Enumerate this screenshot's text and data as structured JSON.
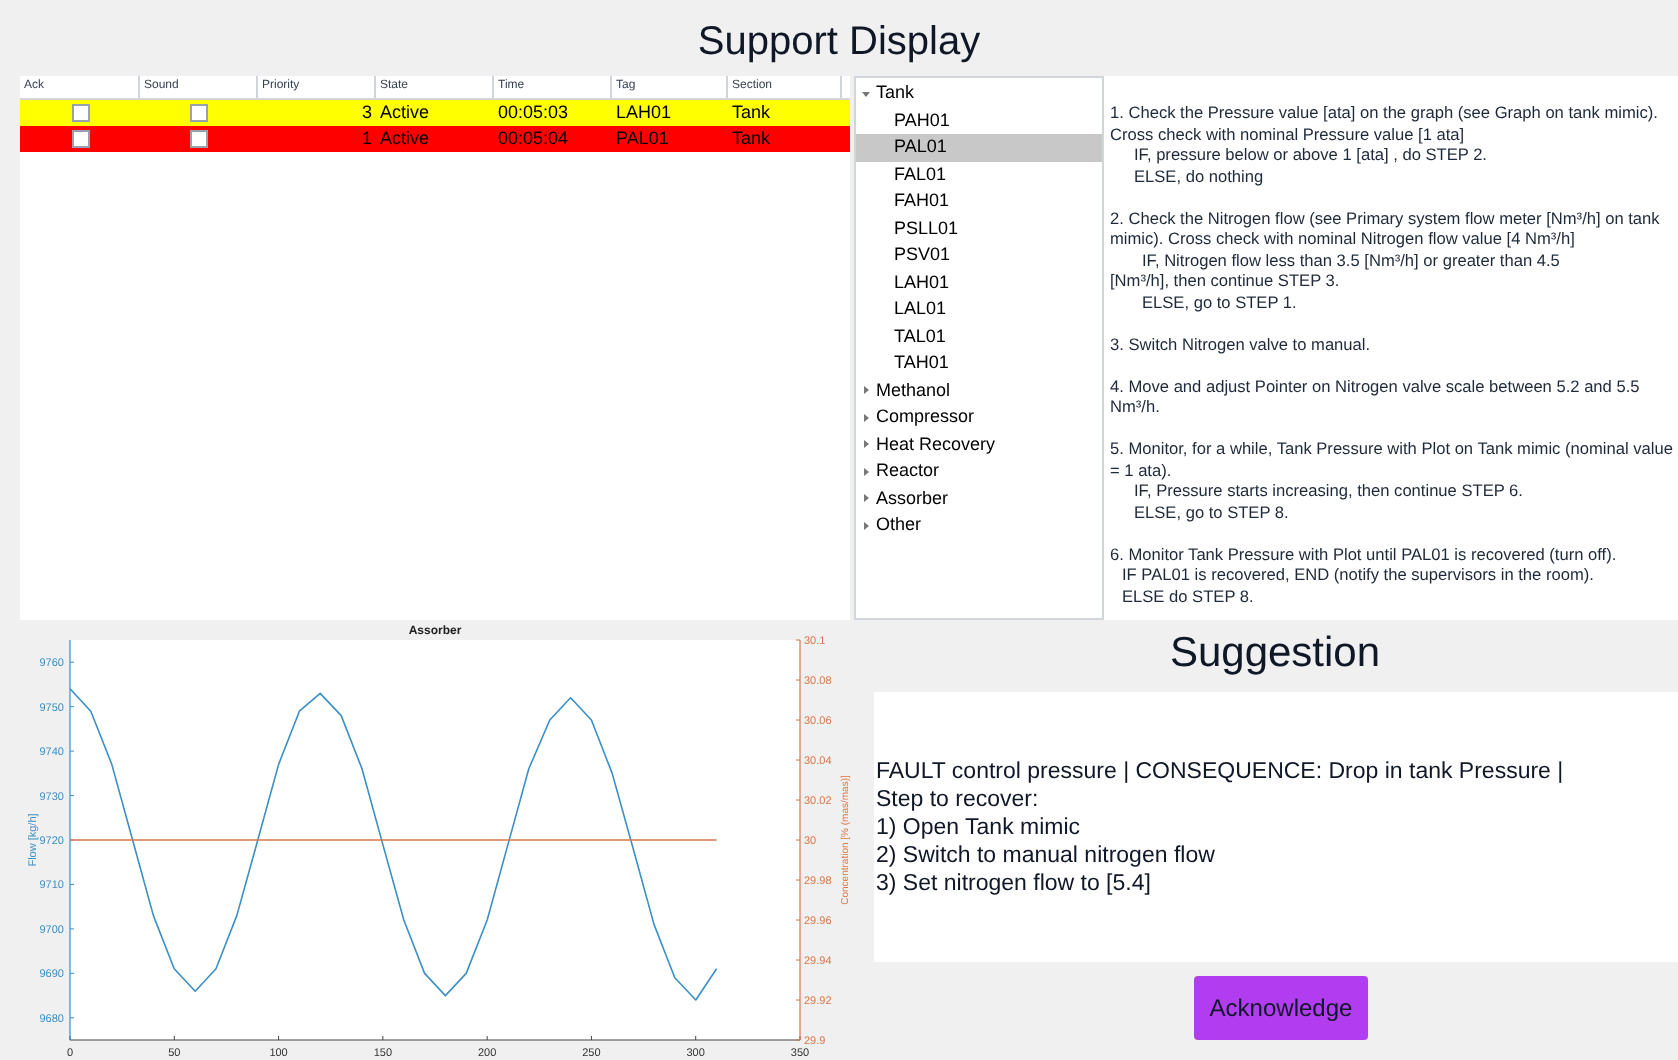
{
  "title": "Support Display",
  "table": {
    "columns": [
      "Ack",
      "Sound",
      "Priority",
      "State",
      "Time",
      "Tag",
      "Section"
    ],
    "rows": [
      {
        "color": "#ffff00",
        "ack": false,
        "sound": false,
        "priority": "3",
        "state": "Active",
        "time": "00:05:03",
        "tag": "LAH01",
        "section": "Tank"
      },
      {
        "color": "#ff0000",
        "ack": false,
        "sound": false,
        "priority": "1",
        "state": "Active",
        "time": "00:05:04",
        "tag": "PAL01",
        "section": "Tank"
      }
    ]
  },
  "tree": [
    {
      "label": "Tank",
      "expanded": true,
      "children": [
        {
          "label": "PAH01",
          "selected": false
        },
        {
          "label": "PAL01",
          "selected": true
        },
        {
          "label": "FAL01",
          "selected": false
        },
        {
          "label": "FAH01",
          "selected": false
        },
        {
          "label": "PSLL01",
          "selected": false
        },
        {
          "label": "PSV01",
          "selected": false
        },
        {
          "label": "LAH01",
          "selected": false
        },
        {
          "label": "LAL01",
          "selected": false
        },
        {
          "label": "TAL01",
          "selected": false
        },
        {
          "label": "TAH01",
          "selected": false
        }
      ]
    },
    {
      "label": "Methanol",
      "expanded": false
    },
    {
      "label": "Compressor",
      "expanded": false
    },
    {
      "label": "Heat Recovery",
      "expanded": false
    },
    {
      "label": "Reactor",
      "expanded": false
    },
    {
      "label": "Assorber",
      "expanded": false
    },
    {
      "label": "Other",
      "expanded": false
    }
  ],
  "procedure": [
    [
      {
        "kind": "main",
        "text": "1.  Check the Pressure value [ata] on the graph (see Graph on tank mimic). Cross check with nominal Pressure value [1 ata]"
      },
      {
        "kind": "sub",
        "text": "IF, pressure below or above 1 [ata] , do STEP 2."
      },
      {
        "kind": "sub",
        "text": "ELSE, do nothing"
      }
    ],
    [
      {
        "kind": "main",
        "text": "2.  Check the Nitrogen flow (see Primary system flow meter [Nm³/h] on tank mimic). Cross check with nominal Nitrogen flow value [4 Nm³/h]"
      },
      {
        "kind": "sub2",
        "text": "IF, Nitrogen flow less than 3.5 [Nm³/h] or greater than 4.5"
      },
      {
        "kind": "main",
        "text": "[Nm³/h], then continue STEP 3."
      },
      {
        "kind": "sub2",
        "text": "ELSE, go to STEP 1."
      }
    ],
    [
      {
        "kind": "main",
        "text": "3.  Switch Nitrogen valve to manual."
      }
    ],
    [
      {
        "kind": "main",
        "text": "4.  Move  and adjust Pointer on Nitrogen valve scale between 5.2 and 5.5 Nm³/h."
      }
    ],
    [
      {
        "kind": "main",
        "text": "5.  Monitor, for a while, Tank Pressure with Plot on Tank mimic (nominal value = 1 ata)."
      },
      {
        "kind": "sub",
        "text": "IF, Pressure starts increasing, then continue STEP 6."
      },
      {
        "kind": "sub",
        "text": "ELSE, go to STEP 8."
      }
    ],
    [
      {
        "kind": "main",
        "text": "6.  Monitor Tank Pressure with Plot until PAL01 is recovered (turn off)."
      },
      {
        "kind": "half",
        "text": "IF PAL01 is recovered, END (notify the supervisors in the room)."
      },
      {
        "kind": "half",
        "text": "ELSE do STEP 8."
      }
    ]
  ],
  "chart_data": {
    "type": "line",
    "title": "Assorber",
    "ylabel": "Flow [kg/h]",
    "y2label": "Concentration [% (mas/mas)]",
    "x": [
      0,
      10,
      20,
      30,
      40,
      50,
      60,
      70,
      80,
      90,
      100,
      110,
      120,
      130,
      140,
      150,
      160,
      170,
      180,
      190,
      200,
      210,
      220,
      230,
      240,
      250,
      260,
      270,
      280,
      290,
      300,
      310
    ],
    "series": [
      {
        "color": "#3b8fc4",
        "values": [
          9754,
          9749,
          9737,
          9720,
          9703,
          9691,
          9686,
          9691,
          9703,
          9720,
          9737,
          9749,
          9753,
          9748,
          9736,
          9719,
          9702,
          9690,
          9685,
          9690,
          9702,
          9719,
          9736,
          9747,
          9752,
          9747,
          9735,
          9718,
          9701,
          9689,
          9684,
          9691
        ]
      },
      {
        "color": "#d9764a",
        "axis": "y2",
        "values": [
          30,
          30,
          30,
          30,
          30,
          30,
          30,
          30,
          30,
          30,
          30,
          30,
          30,
          30,
          30,
          30,
          30,
          30,
          30,
          30,
          30,
          30,
          30,
          30,
          30,
          30,
          30,
          30,
          30,
          30,
          30,
          30
        ]
      }
    ],
    "xlim": [
      0,
      350
    ],
    "ylim": [
      9675,
      9765
    ],
    "y2lim": [
      29.9,
      30.1
    ],
    "xticks": [
      0,
      50,
      100,
      150,
      200,
      250,
      300,
      350
    ],
    "yticks": [
      9680,
      9690,
      9700,
      9710,
      9720,
      9730,
      9740,
      9750,
      9760
    ],
    "y2ticks": [
      {
        "value": 29.9,
        "label": "29.9"
      },
      {
        "value": 29.92,
        "label": "29.92"
      },
      {
        "value": 29.94,
        "label": "29.94"
      },
      {
        "value": 29.96,
        "label": "29.96"
      },
      {
        "value": 29.98,
        "label": "29.98"
      },
      {
        "value": 30,
        "label": "30"
      },
      {
        "value": 30.02,
        "label": "30.02"
      },
      {
        "value": 30.04,
        "label": "30.04"
      },
      {
        "value": 30.06,
        "label": "30.06"
      },
      {
        "value": 30.08,
        "label": "30.08"
      },
      {
        "value": 30.1,
        "label": "30.1"
      }
    ]
  },
  "suggestion": {
    "title": "Suggestion",
    "lines": [
      "FAULT control pressure | CONSEQUENCE: Drop in tank Pressure |",
      "Step to recover:",
      "1) Open Tank mimic",
      "2) Switch to manual nitrogen flow",
      "3) Set nitrogen flow to [5.4]"
    ],
    "button": "Acknowledge"
  }
}
